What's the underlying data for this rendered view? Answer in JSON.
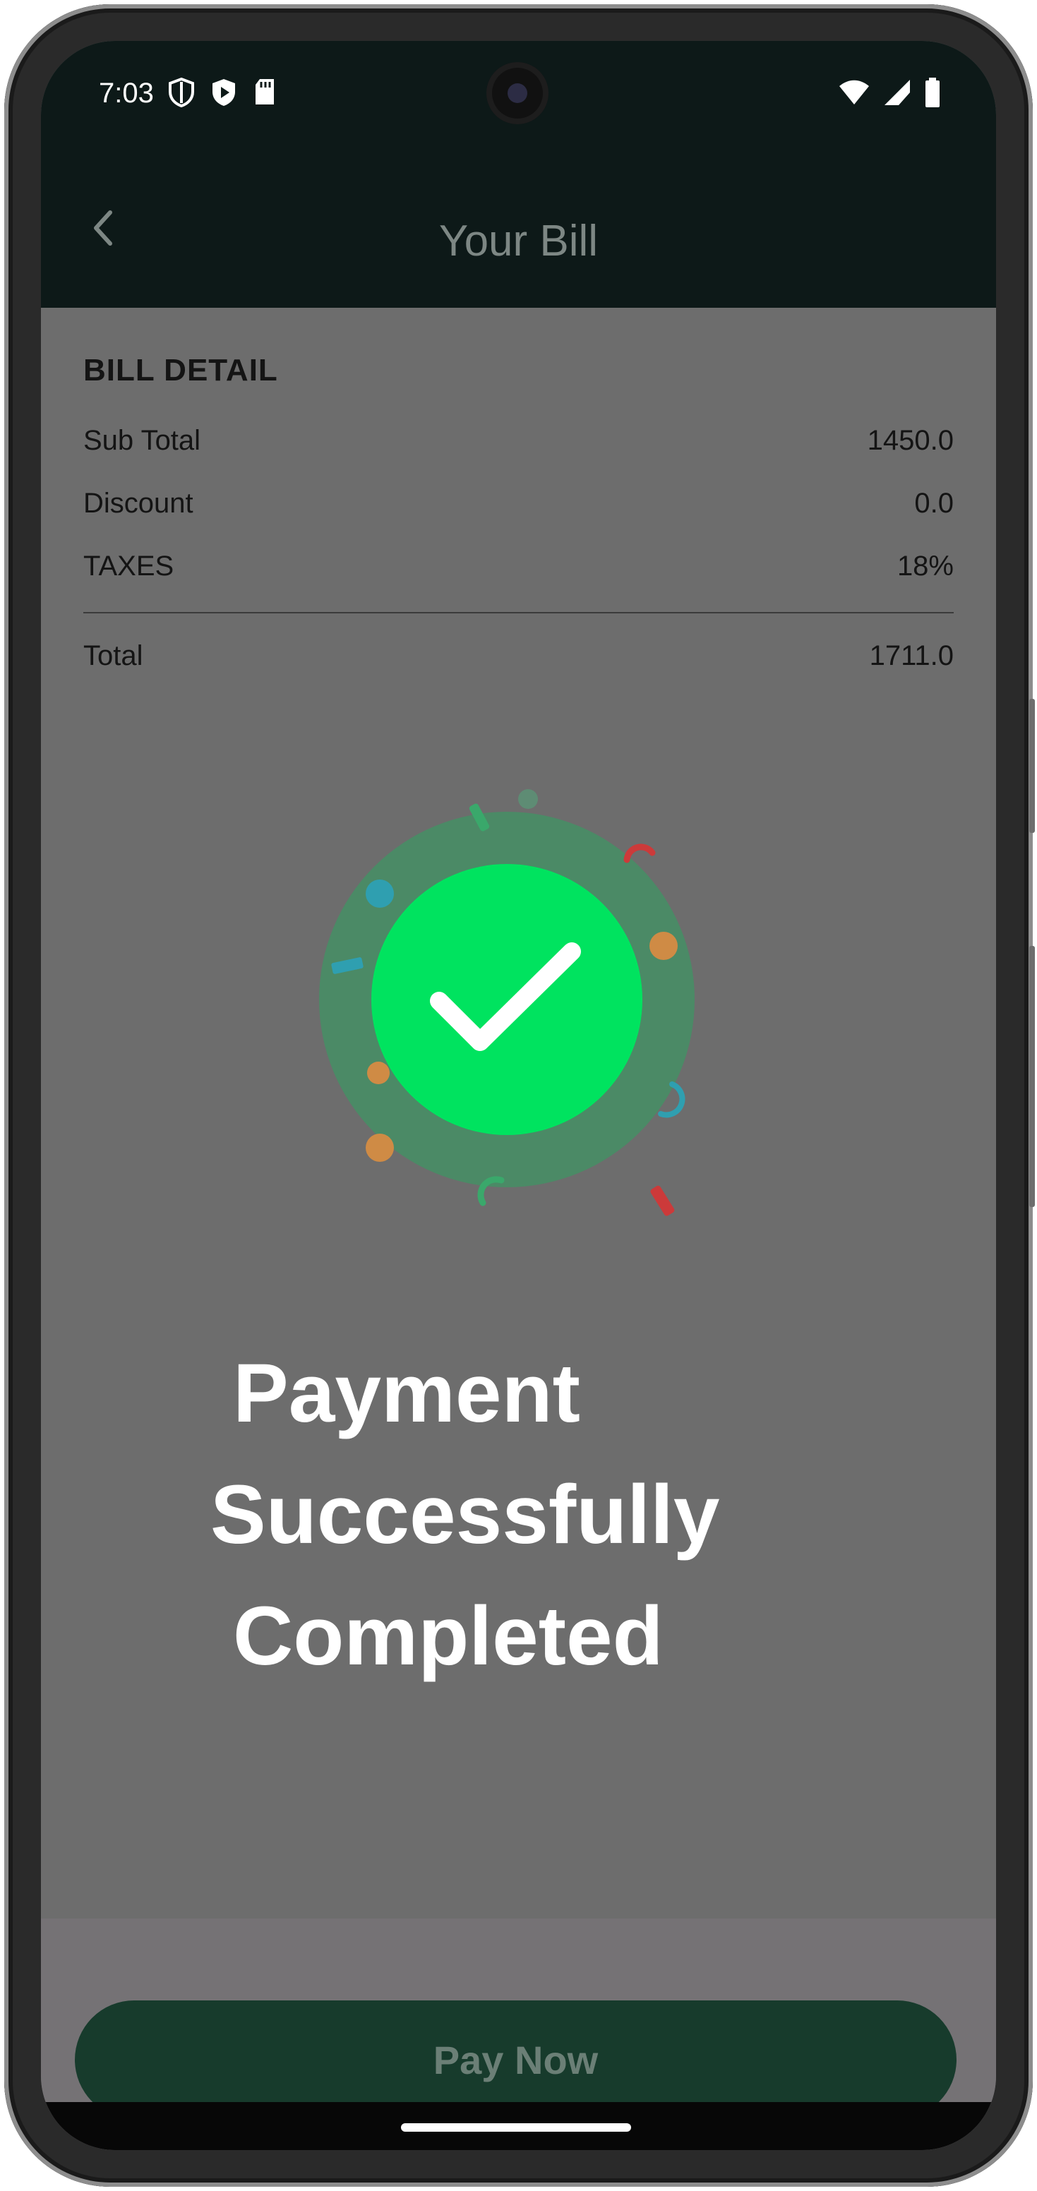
{
  "status_bar": {
    "time": "7:03",
    "icons_left": [
      "shield-icon",
      "play-protect-icon",
      "sd-card-icon"
    ],
    "icons_right": [
      "wifi-icon",
      "signal-icon",
      "battery-icon"
    ]
  },
  "app_bar": {
    "title": "Your Bill",
    "back_icon": "chevron-left-icon"
  },
  "bill": {
    "heading": "BILL DETAIL",
    "rows": [
      {
        "label": "Sub Total",
        "value": "1450.0"
      },
      {
        "label": "Discount",
        "value": "0.0"
      },
      {
        "label": "TAXES",
        "value": "18%"
      }
    ],
    "total": {
      "label": "Total",
      "value": "1711.0"
    }
  },
  "success": {
    "icon": "check-circle-icon",
    "line1": "Payment",
    "line2": "Successfully",
    "line3": "Completed",
    "color": "#00e35f"
  },
  "pay_button": {
    "label": "Pay Now"
  },
  "colors": {
    "dark_bar": "#0d1918",
    "overlay": "#6d6d6d",
    "button": "#173b2c",
    "accent": "#00e35f"
  }
}
